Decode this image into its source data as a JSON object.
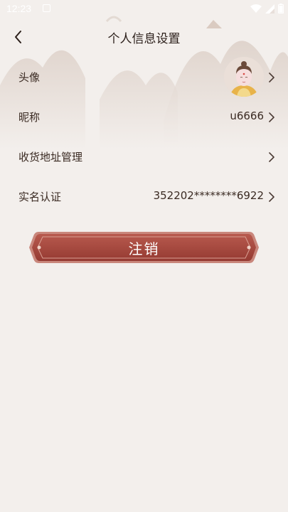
{
  "status_bar": {
    "time": "12:23"
  },
  "nav": {
    "title": "个人信息设置"
  },
  "rows": [
    {
      "label": "头像",
      "value": ""
    },
    {
      "label": "昵称",
      "value": "u6666"
    },
    {
      "label": "收货地址管理",
      "value": ""
    },
    {
      "label": "实名认证",
      "value": "352202********6922"
    }
  ],
  "logout": {
    "label": "注销"
  },
  "icons": {
    "back": "chevron-left-icon",
    "row_arrow": "chevron-right-icon",
    "wifi": "wifi-icon",
    "signal": "signal-icon",
    "battery": "battery-icon",
    "notification": "notification-icon"
  },
  "colors": {
    "background": "#f3efec",
    "button": "#a8463b",
    "button_border": "#c9877c"
  }
}
